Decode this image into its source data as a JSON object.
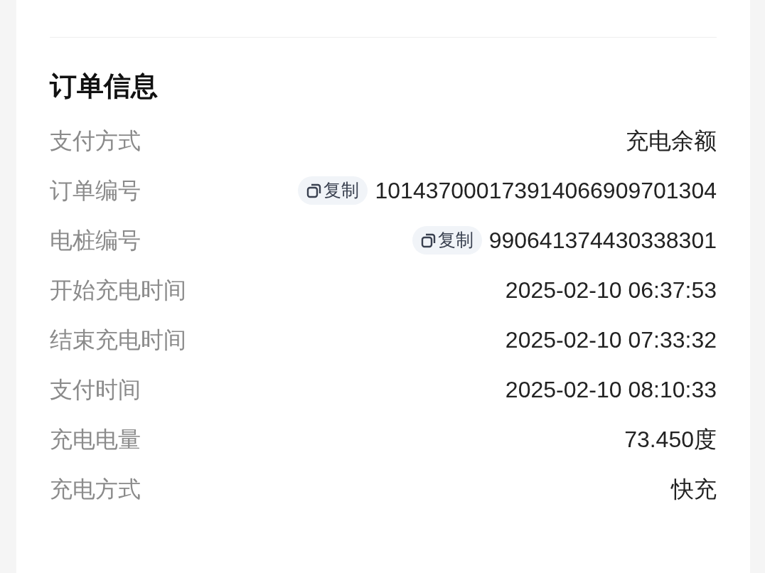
{
  "section": {
    "title": "订单信息"
  },
  "rows": [
    {
      "kind": "text",
      "label": "支付方式",
      "value": "充电余额"
    },
    {
      "kind": "copyable",
      "label": "订单编号",
      "copy_label": "复制",
      "value": "101437000173914066909701304"
    },
    {
      "kind": "copyable",
      "label": "电桩编号",
      "copy_label": "复制",
      "value": "990641374430338301"
    },
    {
      "kind": "text",
      "label": "开始充电时间",
      "value": "2025-02-10 06:37:53"
    },
    {
      "kind": "text",
      "label": "结束充电时间",
      "value": "2025-02-10 07:33:32"
    },
    {
      "kind": "text",
      "label": "支付时间",
      "value": "2025-02-10 08:10:33"
    },
    {
      "kind": "text",
      "label": "充电电量",
      "value": "73.450度"
    },
    {
      "kind": "text",
      "label": "充电方式",
      "value": "快充"
    }
  ]
}
